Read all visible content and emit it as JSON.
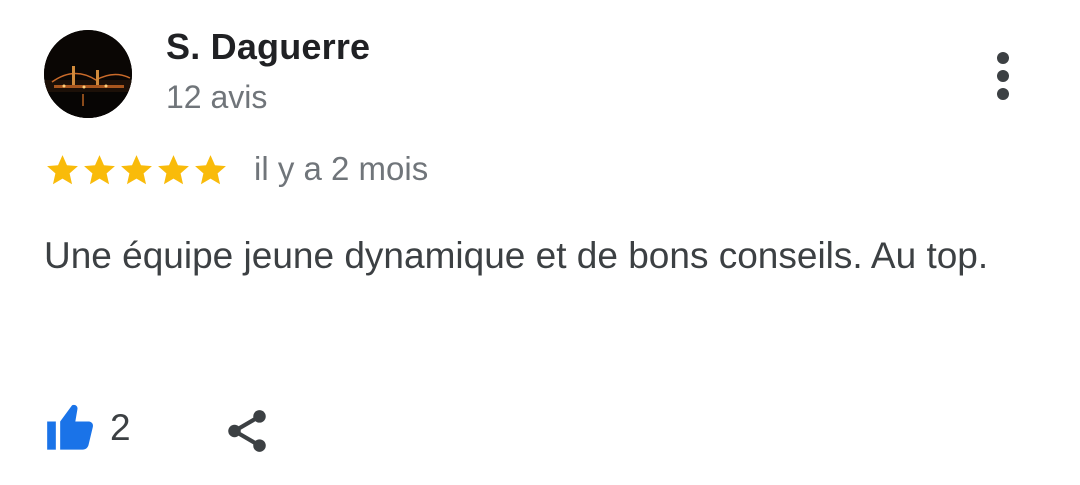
{
  "review": {
    "author": "S. Daguerre",
    "review_count": "12 avis",
    "rating": 5,
    "rating_max": 5,
    "time_ago": "il y a 2 mois",
    "text": "Une équipe jeune dynamique et de bons conseils. Au top.",
    "likes": "2"
  },
  "icons": {
    "avatar": "avatar-photo-night-bridge",
    "menu": "more-vert-icon",
    "star": "star-icon",
    "like": "thumbs-up-icon",
    "share": "share-icon"
  },
  "colors": {
    "star": "#F9BB0A",
    "like": "#1A73E8",
    "name": "#202124",
    "secondary": "#70757A",
    "body": "#3C4043"
  }
}
